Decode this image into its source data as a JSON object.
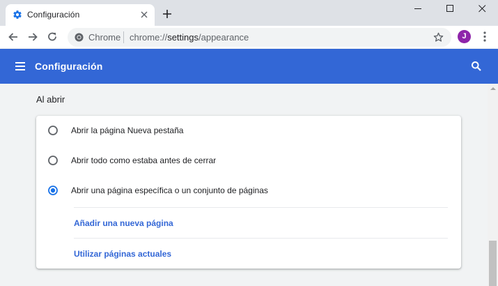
{
  "browser": {
    "tab": {
      "title": "Configuración"
    },
    "omnibox": {
      "site_name": "Chrome",
      "url_scheme": "chrome://",
      "url_host": "settings",
      "url_path": "/appearance"
    },
    "profile_initial": "J",
    "colors": {
      "profile": "#8e24aa",
      "tabstrip": "#dee1e6"
    }
  },
  "header": {
    "title": "Configuración",
    "color": "#3367d6"
  },
  "startup": {
    "section_title": "Al abrir",
    "options": [
      {
        "label": "Abrir la página Nueva pestaña",
        "selected": false
      },
      {
        "label": "Abrir todo como estaba antes de cerrar",
        "selected": false
      },
      {
        "label": "Abrir una página específica o un conjunto de páginas",
        "selected": true
      }
    ],
    "add_page_label": "Añadir una nueva página",
    "use_current_label": "Utilizar páginas actuales"
  },
  "icons": {
    "tab": "gear-icon",
    "close": "close-icon",
    "new_tab": "plus-icon",
    "back": "back-arrow-icon",
    "forward": "forward-arrow-icon",
    "reload": "reload-icon",
    "site": "chrome-icon",
    "bookmark": "star-icon",
    "menu": "kebab-menu-icon",
    "hamburger": "hamburger-menu-icon",
    "search": "search-icon"
  }
}
